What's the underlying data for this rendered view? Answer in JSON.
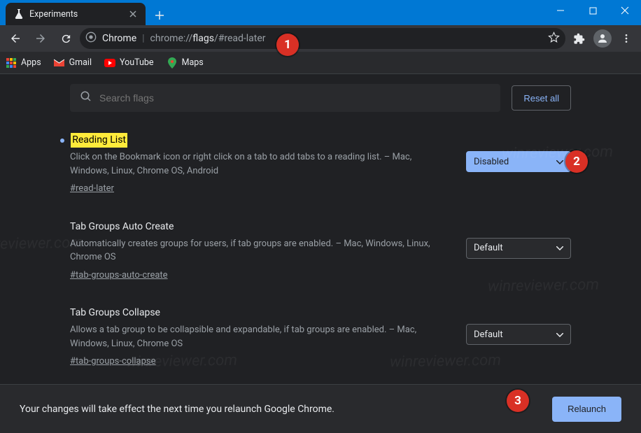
{
  "tab": {
    "title": "Experiments"
  },
  "omnibox": {
    "site_label": "Chrome",
    "url_dim": "chrome://",
    "url_mid": "flags",
    "url_hash": "/#read-later"
  },
  "bookmarks": {
    "apps": "Apps",
    "gmail": "Gmail",
    "youtube": "YouTube",
    "maps": "Maps"
  },
  "search": {
    "placeholder": "Search flags"
  },
  "reset_all": "Reset all",
  "flags": [
    {
      "title": "Reading List",
      "highlight": true,
      "bullet": true,
      "desc": "Click on the Bookmark icon or right click on a tab to add tabs to a reading list. – Mac, Windows, Linux, Chrome OS, Android",
      "anchor": "#read-later",
      "value": "Disabled",
      "active_select": true
    },
    {
      "title": "Tab Groups Auto Create",
      "highlight": false,
      "bullet": false,
      "desc": "Automatically creates groups for users, if tab groups are enabled. – Mac, Windows, Linux, Chrome OS",
      "anchor": "#tab-groups-auto-create",
      "value": "Default",
      "active_select": false
    },
    {
      "title": "Tab Groups Collapse",
      "highlight": false,
      "bullet": false,
      "desc": "Allows a tab group to be collapsible and expandable, if tab groups are enabled. – Mac, Windows, Linux, Chrome OS",
      "anchor": "#tab-groups-collapse",
      "value": "Default",
      "active_select": false
    }
  ],
  "relaunch": {
    "message": "Your changes will take effect the next time you relaunch Google Chrome.",
    "button": "Relaunch"
  },
  "badges": {
    "b1": "1",
    "b2": "2",
    "b3": "3"
  },
  "watermark": "winreviewer.com"
}
